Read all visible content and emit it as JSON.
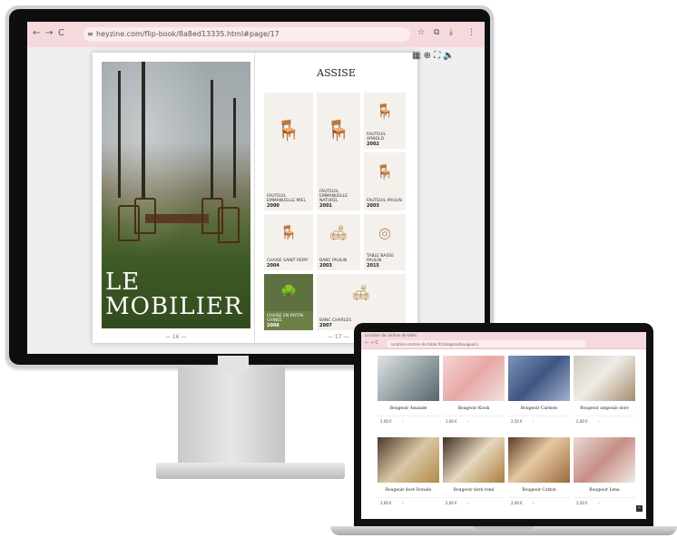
{
  "desktop": {
    "browser": {
      "url": "heyzine.com/flip-book/8a8ed13335.html#page/17",
      "nav_back": "←",
      "nav_forward": "→",
      "nav_reload": "C",
      "lock_icon": "tune-icon",
      "star_icon": "☆",
      "ext_icon": "⧉",
      "download_icon": "⤓",
      "menu_icon": "⋮"
    },
    "flipbook": {
      "left_page": {
        "title_line1": "LE",
        "title_line2": "MOBILIER",
        "page_number": "— 16 —"
      },
      "right_page": {
        "title": "ASSISE",
        "page_number": "— 17 —",
        "products": [
          {
            "name": "FAUTEUIL EMMANUELLE MIEL",
            "code": "2000"
          },
          {
            "name": "FAUTEUIL EMMANUELLE NATUREL",
            "code": "2001"
          },
          {
            "name": "FAUTEUIL ARNOLD",
            "code": "2002"
          },
          {
            "name": "FAUTEUIL PAULIN",
            "code": "2003"
          },
          {
            "name": "CHAISE SAINT RÉMY",
            "code": "2004"
          },
          {
            "name": "BANC PAULIN",
            "code": "2003"
          },
          {
            "name": "TABLE BASSE PAULIN",
            "code": "2015"
          },
          {
            "name": "CHAISE EN ROTIN CHINÉE",
            "code": "2006"
          },
          {
            "name": "BANC CHARLES",
            "code": "2007"
          }
        ]
      },
      "tools": {
        "grid": "▦",
        "zoom": "⊕",
        "fullscreen": "⛶",
        "sound": "🔈"
      }
    }
  },
  "laptop": {
    "browser": {
      "tab": "Location de centres de table",
      "url": "location-centres-de-table.fr/categorie/bougeoirs",
      "nav": "← → C"
    },
    "products_row1": [
      {
        "name": "Bougeoir Amande",
        "price": "2,00 €"
      },
      {
        "name": "Bougeoir Kiosk",
        "price": "1,00 €"
      },
      {
        "name": "Bougeoir Carmen",
        "price": "2,50 €"
      },
      {
        "name": "Bougeoir ampoule dore",
        "price": "2,00 €"
      }
    ],
    "products_row2": [
      {
        "name": "Bougeoir doré Dorado",
        "price": "2,00 €"
      },
      {
        "name": "Bougeoir doré rond",
        "price": "2,00 €"
      },
      {
        "name": "Bougeoir Cotton",
        "price": "2,00 €"
      },
      {
        "name": "Bougeoir Lena",
        "price": "2,50 €"
      }
    ],
    "scroll_top": "^"
  },
  "colors": {
    "browser_pink": "#f6d9dc",
    "bezel": "#0e0e0f",
    "aluminium": "#cfd0d2"
  }
}
